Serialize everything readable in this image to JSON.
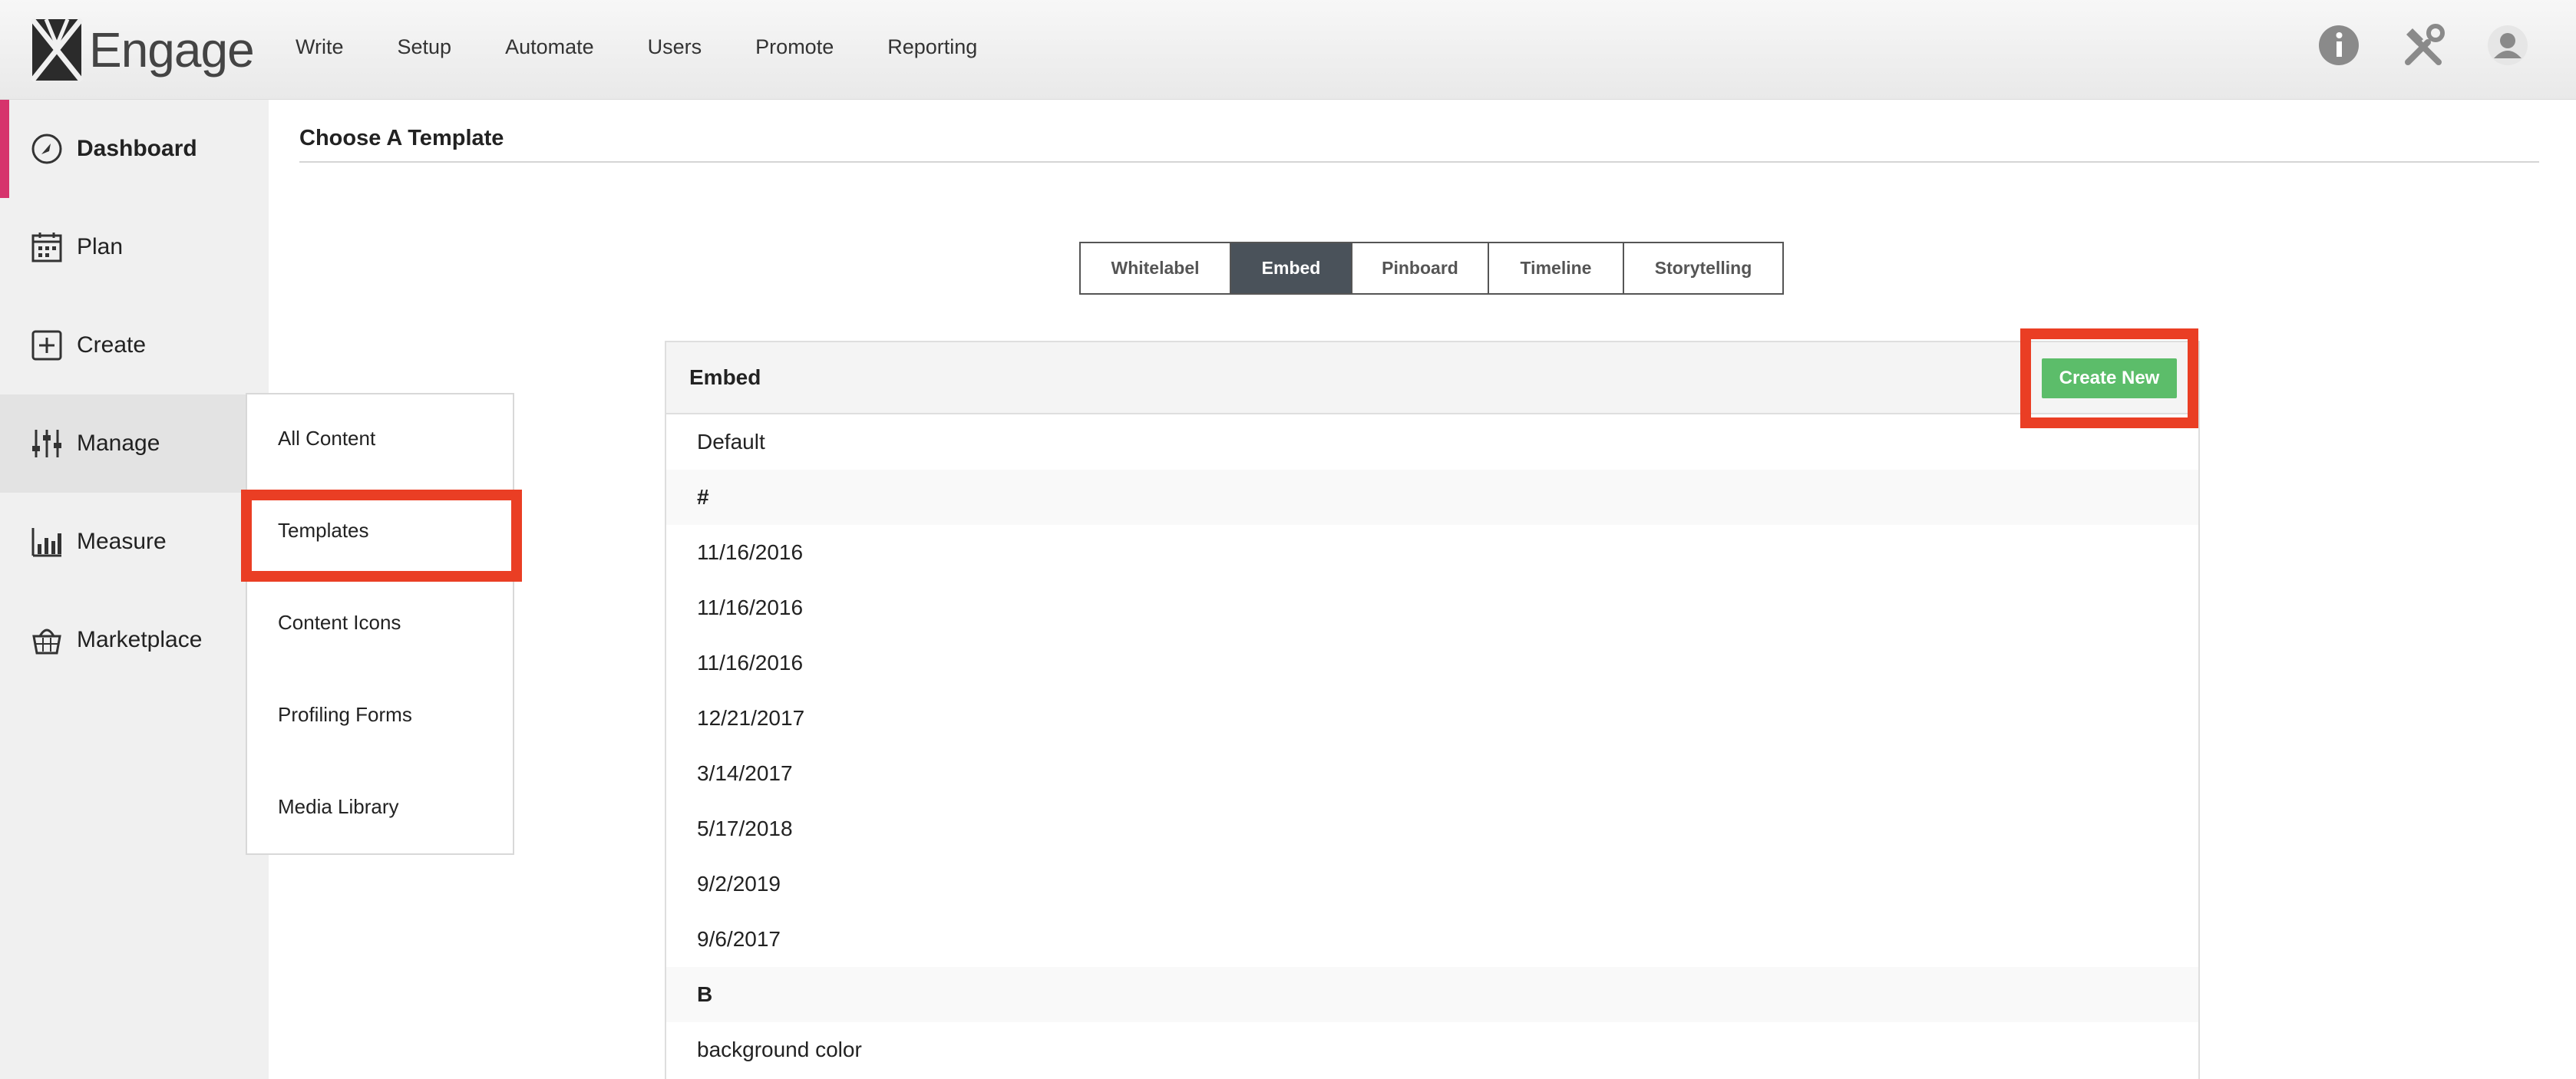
{
  "app": {
    "name": "Engage"
  },
  "topnav": [
    "Write",
    "Setup",
    "Automate",
    "Users",
    "Promote",
    "Reporting"
  ],
  "top_icons": [
    "info-icon",
    "tools-icon",
    "user-icon"
  ],
  "sidebar": {
    "items": [
      {
        "label": "Dashboard",
        "icon": "dashboard-icon"
      },
      {
        "label": "Plan",
        "icon": "calendar-icon"
      },
      {
        "label": "Create",
        "icon": "plus-square-icon"
      },
      {
        "label": "Manage",
        "icon": "sliders-icon"
      },
      {
        "label": "Measure",
        "icon": "bar-chart-icon"
      },
      {
        "label": "Marketplace",
        "icon": "basket-icon"
      }
    ]
  },
  "manage_menu": [
    "All Content",
    "Templates",
    "Content Icons",
    "Profiling Forms",
    "Media Library"
  ],
  "page": {
    "title": "Choose A Template"
  },
  "tabs": [
    "Whitelabel",
    "Embed",
    "Pinboard",
    "Timeline",
    "Storytelling"
  ],
  "active_tab": "Embed",
  "panel": {
    "title": "Embed",
    "create_label": "Create New",
    "rows": [
      {
        "text": "Default",
        "section": false
      },
      {
        "text": "#",
        "section": true
      },
      {
        "text": "11/16/2016",
        "section": false
      },
      {
        "text": "11/16/2016",
        "section": false
      },
      {
        "text": "11/16/2016",
        "section": false
      },
      {
        "text": "12/21/2017",
        "section": false
      },
      {
        "text": "3/14/2017",
        "section": false
      },
      {
        "text": "5/17/2018",
        "section": false
      },
      {
        "text": "9/2/2019",
        "section": false
      },
      {
        "text": "9/6/2017",
        "section": false
      },
      {
        "text": "B",
        "section": true
      },
      {
        "text": "background color",
        "section": false
      }
    ]
  },
  "colors": {
    "accent": "#d6336c",
    "highlight": "#ea3e24",
    "create_button": "#5cbd6a",
    "active_tab": "#4a525a"
  }
}
